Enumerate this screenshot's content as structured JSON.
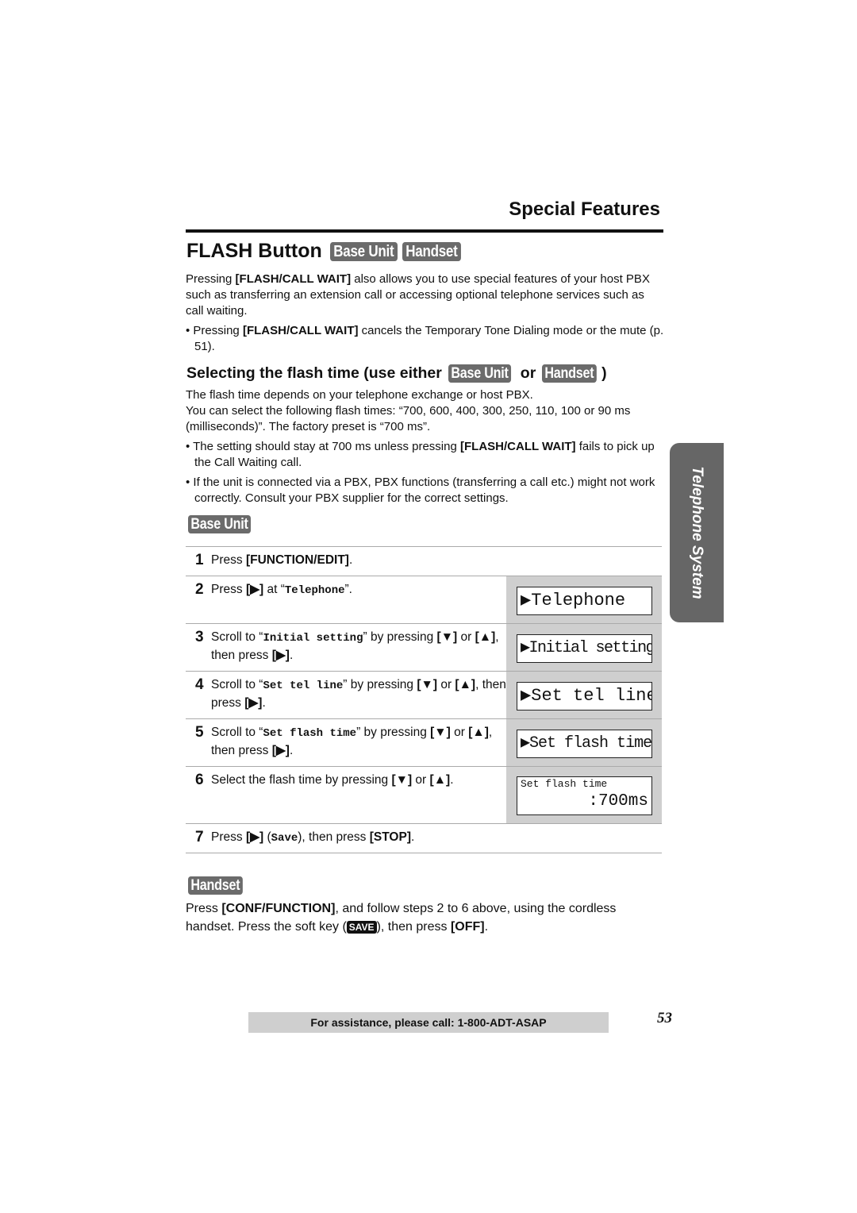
{
  "header": {
    "section_title": "Special Features"
  },
  "heading": {
    "title": "FLASH Button",
    "tags": [
      "Base Unit",
      "Handset"
    ]
  },
  "intro": {
    "p1_a": "Pressing ",
    "p1_key": "[FLASH/CALL WAIT]",
    "p1_b": " also allows you to use special features of your host PBX such as transferring an extension call or accessing optional telephone services such as call waiting.",
    "bullet1_a": "• Pressing ",
    "bullet1_key": "[FLASH/CALL WAIT]",
    "bullet1_b": " cancels the Temporary Tone Dialing mode or the mute (p. 51)."
  },
  "subsection": {
    "title": "Selecting the flash time (use either",
    "tag1": "Base Unit",
    "or_label": "or",
    "tag2": "Handset",
    "close": ")",
    "line1": "The flash time depends on your telephone exchange or host PBX.",
    "line2": "You can select the following flash times: “700, 600, 400, 300, 250, 110, 100 or 90 ms (milliseconds)”. The factory preset is “700 ms”.",
    "bullet1_a": "• The setting should stay at 700 ms unless pressing ",
    "bullet1_key": "[FLASH/CALL WAIT]",
    "bullet1_b": " fails to pick up the Call Waiting call.",
    "bullet2": "• If the unit is connected via a PBX, PBX functions (transferring a call etc.) might not work correctly. Consult your PBX supplier for the correct settings."
  },
  "base_unit": {
    "tag": "Base Unit",
    "steps": [
      {
        "num": "1",
        "a": "Press ",
        "b": "[FUNCTION/EDIT]",
        "c": "."
      },
      {
        "num": "2",
        "a": "Press ",
        "b": "[▶]",
        "c": " at “",
        "d": "Telephone",
        "e": "”.",
        "lcd": "▶Telephone"
      },
      {
        "num": "3",
        "a": "Scroll to “",
        "b": "Initial setting",
        "c": "” by pressing ",
        "d": "[▼]",
        "e": " or ",
        "f": "[▲]",
        "g": ", then press ",
        "h": "[▶]",
        "i": ".",
        "lcd": "▶Initial setting"
      },
      {
        "num": "4",
        "a": "Scroll to “",
        "b": "Set tel line",
        "c": "” by pressing ",
        "d": "[▼]",
        "e": " or ",
        "f": "[▲]",
        "g": ", then press ",
        "h": "[▶]",
        "i": ".",
        "lcd": "▶Set tel line"
      },
      {
        "num": "5",
        "a": "Scroll to “",
        "b": "Set flash time",
        "c": "” by pressing ",
        "d": "[▼]",
        "e": " or ",
        "f": "[▲]",
        "g": ", then press ",
        "h": "[▶]",
        "i": ".",
        "lcd": "▶Set flash time"
      },
      {
        "num": "6",
        "a": "Select the flash time by pressing ",
        "b": "[▼]",
        "c": " or ",
        "d": "[▲]",
        "e": ".",
        "lcd_line1": "Set flash time",
        "lcd_line2": ":700ms"
      },
      {
        "num": "7",
        "a": "Press ",
        "b": "[▶]",
        "c": " (",
        "d": "Save",
        "e": "), then press ",
        "f": "[STOP]",
        "g": "."
      }
    ]
  },
  "handset": {
    "tag": "Handset",
    "a": "Press ",
    "key1": "[CONF/FUNCTION]",
    "b": ", and follow steps 2 to 6 above, using the cordless handset. Press the soft key (",
    "softkey": "SAVE",
    "c": "), then press ",
    "key2": "[OFF]",
    "d": "."
  },
  "side_tab": {
    "label": "Telephone System"
  },
  "footer": {
    "assist": "For assistance, please call: 1-800-ADT-ASAP",
    "page": "53"
  }
}
